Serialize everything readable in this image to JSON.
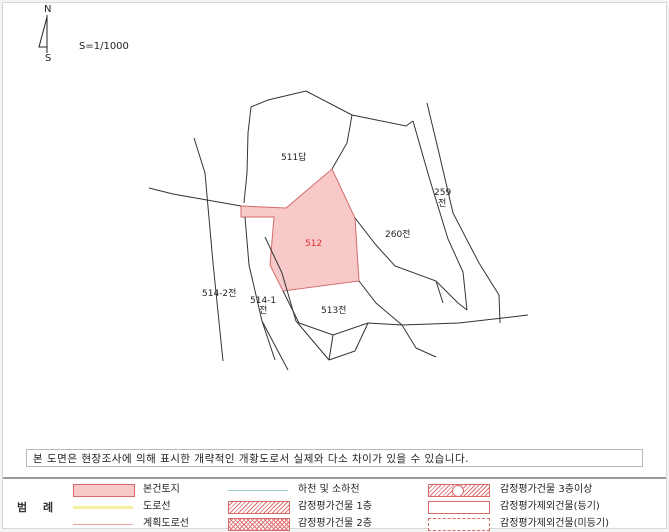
{
  "map": {
    "north_label": "N",
    "south_label": "S",
    "scale_label": "S=1/1000",
    "parcels": {
      "p511": "511답",
      "p512": "512",
      "p260": "260전",
      "p259a": "259",
      "p259b": "전",
      "p514_2": "514-2전",
      "p514_1a": "514-1",
      "p514_1b": "전",
      "p513": "513전"
    },
    "colors": {
      "subject_fill": "#f7c9c9",
      "subject_stroke": "#d46a6a",
      "subject_label": "#e03030",
      "boundary": "#333333"
    }
  },
  "notice": "본 도면은 현장조사에 의해 표시한 개략적인 개황도로서 실제와 다소 차이가 있을 수 있습니다.",
  "legend": {
    "title": "범 례",
    "items": [
      {
        "label": "본건토지",
        "symbol": "pink-fill"
      },
      {
        "label": "하천 및 소하천",
        "symbol": "blue-line"
      },
      {
        "label": "감정평가건물 3층이상",
        "symbol": "hatched-circle"
      },
      {
        "label": "도로선",
        "symbol": "yellow-line"
      },
      {
        "label": "감정평가건물 1층",
        "symbol": "red-hatch"
      },
      {
        "label": "감정평가제외건물(등기)",
        "symbol": "empty-box"
      },
      {
        "label": "계획도로선",
        "symbol": "pink-line"
      },
      {
        "label": "감정평가건물 2층",
        "symbol": "cross-hatch"
      },
      {
        "label": "감정평가제외건물(미등기)",
        "symbol": "dashed-box"
      }
    ]
  }
}
